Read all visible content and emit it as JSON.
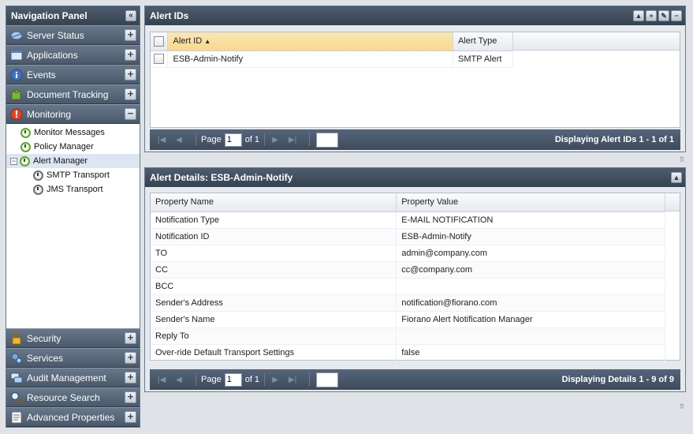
{
  "nav": {
    "title": "Navigation Panel",
    "top_items": [
      {
        "label": "Server Status",
        "icon": "server-icon",
        "state": "+"
      },
      {
        "label": "Applications",
        "icon": "applications-icon",
        "state": "+"
      },
      {
        "label": "Events",
        "icon": "info-icon",
        "state": "+"
      },
      {
        "label": "Document Tracking",
        "icon": "puzzle-icon",
        "state": "+"
      },
      {
        "label": "Monitoring",
        "icon": "alert-icon",
        "state": "−"
      }
    ],
    "tree": [
      {
        "label": "Monitor Messages",
        "level": 1
      },
      {
        "label": "Policy Manager",
        "level": 1
      },
      {
        "label": "Alert Manager",
        "level": 1,
        "expanded": true,
        "selected": true
      },
      {
        "label": "SMTP Transport",
        "level": 2
      },
      {
        "label": "JMS Transport",
        "level": 2
      }
    ],
    "bottom_items": [
      {
        "label": "Security",
        "icon": "lock-icon",
        "state": "+"
      },
      {
        "label": "Services",
        "icon": "services-icon",
        "state": "+"
      },
      {
        "label": "Audit Management",
        "icon": "chat-icon",
        "state": "+"
      },
      {
        "label": "Resource Search",
        "icon": "search-icon",
        "state": "+"
      },
      {
        "label": "Advanced Properties",
        "icon": "properties-icon",
        "state": "+"
      }
    ]
  },
  "alert_ids": {
    "title": "Alert IDs",
    "columns": [
      "Alert ID",
      "Alert Type"
    ],
    "sort_indicator": "▲",
    "rows": [
      [
        "ESB-Admin-Notify",
        "SMTP Alert"
      ]
    ],
    "pager": {
      "page_label": "Page",
      "page_value": "1",
      "of_label": "of 1",
      "status": "Displaying Alert IDs 1 - 1 of 1"
    }
  },
  "alert_details": {
    "title": "Alert Details: ESB-Admin-Notify",
    "columns": [
      "Property Name",
      "Property Value"
    ],
    "rows": [
      [
        "Notification Type",
        "E-MAIL NOTIFICATION"
      ],
      [
        "Notification ID",
        "ESB-Admin-Notify"
      ],
      [
        "TO",
        "admin@company.com"
      ],
      [
        "CC",
        "cc@company.com"
      ],
      [
        "BCC",
        ""
      ],
      [
        "Sender's Address",
        "notification@fiorano.com"
      ],
      [
        "Sender's Name",
        "Fiorano Alert Notification Manager"
      ],
      [
        "Reply To",
        ""
      ],
      [
        "Over-ride Default Transport Settings",
        "false"
      ]
    ],
    "pager": {
      "page_label": "Page",
      "page_value": "1",
      "of_label": "of 1",
      "status": "Displaying Details 1 - 9 of 9"
    }
  },
  "colors": {
    "header": "#3d4a5b",
    "accent_sort": "#f7d88c",
    "selection": "#dce6f3"
  }
}
